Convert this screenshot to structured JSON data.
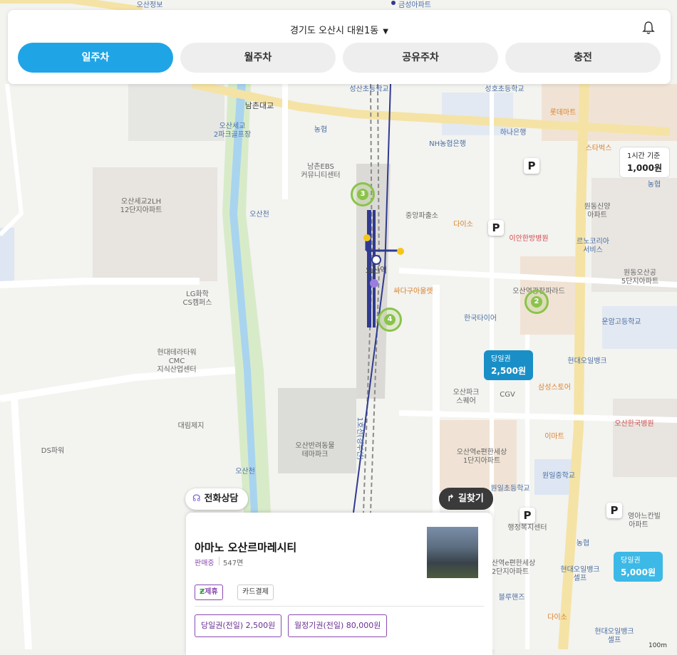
{
  "header": {
    "location": "경기도 오산시 대원1동",
    "tabs": [
      {
        "label": "일주차",
        "active": true
      },
      {
        "label": "월주차",
        "active": false
      },
      {
        "label": "공유주차",
        "active": false
      },
      {
        "label": "충전",
        "active": false
      }
    ]
  },
  "map": {
    "labels": {
      "l1": "오산정보",
      "l2": "금성아파트",
      "l3": "성산초등학교",
      "l4": "성호초등학교",
      "l5": "남촌대교",
      "l6": "오산세교",
      "l6b": "2파크골프장",
      "l7": "농협",
      "l8": "롯데마트",
      "l9": "하나은행",
      "l10": "NH농협은행",
      "l11": "스타벅스",
      "l12": "남촌EBS",
      "l12b": "커뮤니티센터",
      "l13": "오산세교2LH",
      "l13b": "12단지아파트",
      "l14": "오산천",
      "l15": "중앙파출소",
      "l16": "다이소",
      "l17": "이안한방병원",
      "l18": "원동신양",
      "l18b": "아파트",
      "l19": "르노코리아",
      "l19b": "서비스",
      "l20": "오산역",
      "l21": "싸다구아울렛",
      "l22": "오산역광장파라드",
      "l23": "원동오산공",
      "l23b": "5단지아파트",
      "l24": "LG화학",
      "l24b": "CS캠퍼스",
      "l25": "한국타이어",
      "l26": "운암고등학교",
      "l27": "현대테라타워",
      "l27b": "CMC",
      "l27c": "지식산업센터",
      "l28": "현대오일뱅크",
      "l29": "오산파크",
      "l29b": "스퀘어",
      "l30": "CGV",
      "l31": "삼성스토어",
      "l32": "대림제지",
      "l33": "오산반려동물",
      "l33b": "테마파크",
      "l34": "오산한국병원",
      "l35": "이마트",
      "l36": "DS파워",
      "l37": "오산역e편한세상",
      "l37b": "1단지아파트",
      "l38": "원일중학교",
      "l39": "오산천",
      "l40": "원일초등학교",
      "l41": "행정복지센터",
      "l42": "영아느칸빌",
      "l42b": "아파트",
      "l43": "농협",
      "l44": "오산역e편한세상",
      "l44b": "2단지아파트",
      "l45": "현대오일뱅크",
      "l45b": "셀프",
      "l46": "블루핸즈",
      "l47": "다이소",
      "l48": "현대오일뱅크",
      "l48b": "셀프",
      "l49": "농협",
      "l50": "1호선(경부선)"
    },
    "clusters": [
      "3",
      "2",
      "4"
    ],
    "price_pins": [
      {
        "title": "1시간 기준",
        "price": "1,000원"
      },
      {
        "title": "당일권",
        "price": "2,500원"
      },
      {
        "title": "당일권",
        "price": "5,000원"
      }
    ],
    "parking_icon": "P",
    "scale": "100m"
  },
  "actions": {
    "call": "전화상담",
    "directions": "길찾기"
  },
  "card": {
    "name": "아마노 오산르마레시티",
    "status": "판매중",
    "spaces": "547면",
    "tags": [
      "제휴",
      "카드결제"
    ],
    "tickets": [
      "당일권(전일) 2,500원",
      "월정기권(전일) 80,000원"
    ]
  },
  "colors": {
    "accent": "#1fa5e6",
    "purple": "#8a4ab0",
    "green_cluster": "#8bc34a",
    "pin_blue": "#1a8fc7",
    "pin_light": "#3cb9e6"
  }
}
